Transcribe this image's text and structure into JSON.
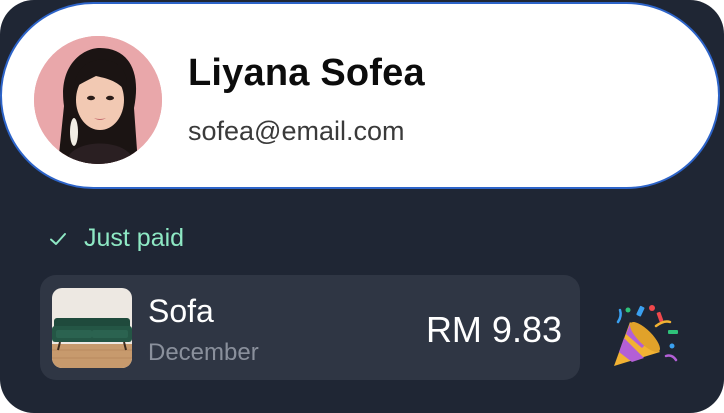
{
  "profile": {
    "name": "Liyana Sofea",
    "email": "sofea@email.com",
    "avatar_icon": "user-avatar-photo"
  },
  "status": {
    "label": "Just paid",
    "icon": "check-icon",
    "color": "#8ee8c4"
  },
  "transaction": {
    "item_name": "Sofa",
    "period": "December",
    "amount": "RM 9.83",
    "thumbnail_icon": "sofa-thumbnail"
  },
  "celebration_icon": "party-popper-icon",
  "colors": {
    "card_background": "#1f2634",
    "row_background": "#2f3644",
    "profile_border": "#2d64c9",
    "accent_green": "#8ee8c4"
  }
}
